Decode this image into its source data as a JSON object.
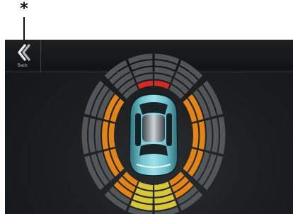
{
  "callout": {
    "marker": "*"
  },
  "toolbar": {
    "back_label": "Back",
    "back_icon": "chevron-left-icon"
  },
  "parking_display": {
    "icon": "car-top-view-icon",
    "colors": {
      "inactive": "#5d6063",
      "red": "#d42a24",
      "orange": "#e28418",
      "yellow": "#d8c63a",
      "car_body": "#6fc3cf"
    },
    "front": {
      "zones": [
        {
          "zone": "front-left-outer",
          "active_level": 0,
          "color": "inactive"
        },
        {
          "zone": "front-left-inner",
          "active_level": 1,
          "color": "red"
        },
        {
          "zone": "front-right-inner",
          "active_level": 1,
          "color": "red"
        },
        {
          "zone": "front-right-outer",
          "active_level": 0,
          "color": "inactive"
        }
      ]
    },
    "left_side": {
      "zones": [
        {
          "zone": "left-front",
          "active_level": 2,
          "color": "orange"
        },
        {
          "zone": "left-middle",
          "active_level": 2,
          "color": "orange"
        },
        {
          "zone": "left-rear",
          "active_level": 2,
          "color": "orange"
        }
      ]
    },
    "right_side": {
      "zones": [
        {
          "zone": "right-front",
          "active_level": 2,
          "color": "orange"
        },
        {
          "zone": "right-middle",
          "active_level": 2,
          "color": "orange"
        },
        {
          "zone": "right-rear",
          "active_level": 2,
          "color": "orange"
        }
      ]
    },
    "rear": {
      "zones": [
        {
          "zone": "rear-left-outer",
          "active_level": 3,
          "color": "orange"
        },
        {
          "zone": "rear-left-inner",
          "active_level": 4,
          "color": "yellow"
        },
        {
          "zone": "rear-right-inner",
          "active_level": 4,
          "color": "yellow"
        },
        {
          "zone": "rear-right-outer",
          "active_level": 3,
          "color": "orange"
        }
      ]
    }
  }
}
